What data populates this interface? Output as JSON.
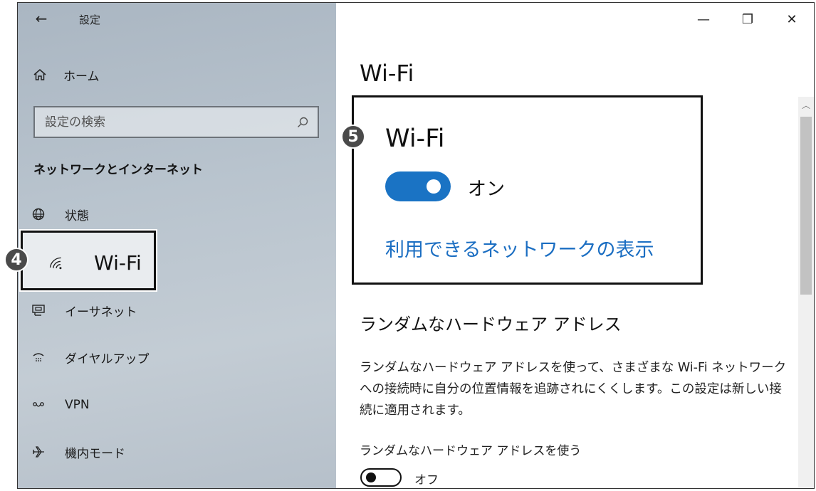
{
  "window": {
    "title": "設定",
    "controls": {
      "minimize": "—",
      "maximize": "❐",
      "close": "✕"
    }
  },
  "sidebar": {
    "back_glyph": "←",
    "home_label": "ホーム",
    "search_placeholder": "設定の検索",
    "section_title": "ネットワークとインターネット",
    "items": [
      {
        "label": "状態",
        "icon": "globe-icon"
      },
      {
        "label": "Wi-Fi",
        "icon": "wifi-icon",
        "selected": true
      },
      {
        "label": "イーサネット",
        "icon": "ethernet-icon"
      },
      {
        "label": "ダイヤルアップ",
        "icon": "dialup-icon"
      },
      {
        "label": "VPN",
        "icon": "vpn-icon"
      },
      {
        "label": "機内モード",
        "icon": "airplane-icon"
      }
    ]
  },
  "badges": {
    "b4": "4",
    "b5": "5"
  },
  "main": {
    "page_title": "Wi-Fi",
    "wifi_card": {
      "title": "Wi-Fi",
      "toggle_state": "オン",
      "toggle_on": true,
      "link": "利用できるネットワークの表示"
    },
    "random_hw": {
      "heading": "ランダムなハードウェア アドレス",
      "description": "ランダムなハードウェア アドレスを使って、さまざまな Wi-Fi ネットワークへの接続時に自分の位置情報を追跡されにくくします。この設定は新しい接続に適用されます。",
      "toggle_label": "ランダムなハードウェア アドレスを使う",
      "toggle_state": "オフ",
      "toggle_on": false
    }
  },
  "colors": {
    "accent": "#1a73c4",
    "link": "#1b6ec2",
    "sidebar_bg": "#b9c4ce"
  }
}
